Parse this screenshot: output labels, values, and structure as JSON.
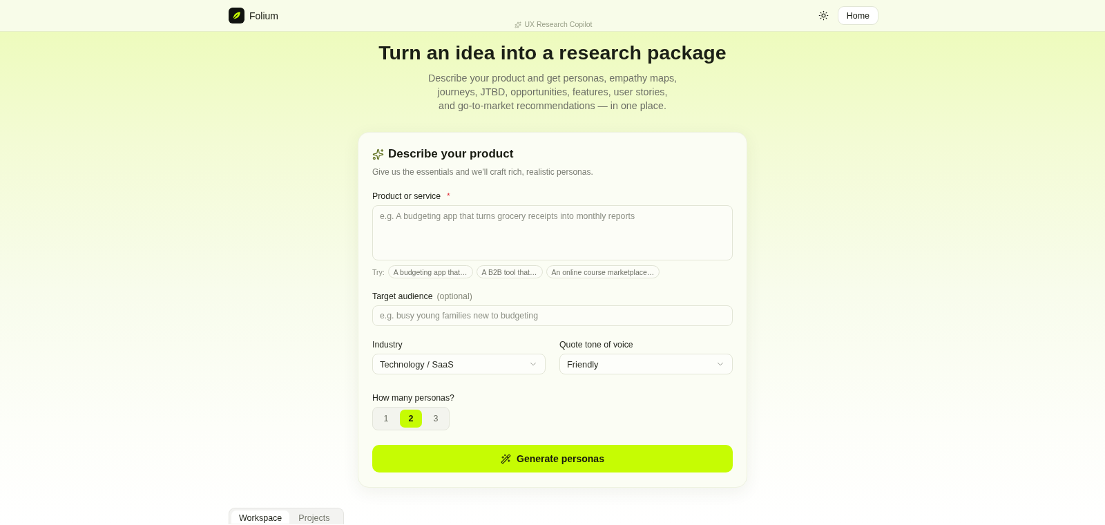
{
  "header": {
    "brand": "Folium",
    "home_button": "Home",
    "eyebrow": "UX Research Copilot"
  },
  "hero": {
    "title": "Turn an idea into a research package",
    "subtitle": "Describe your product and get personas, empathy maps, journeys, JTBD, opportunities, features, user stories, and go-to-market recommendations — in one place."
  },
  "card": {
    "title": "Describe your product",
    "subtitle": "Give us the essentials and we'll craft rich, realistic personas.",
    "product": {
      "label": "Product or service",
      "required_mark": "*",
      "placeholder": "e.g. A budgeting app that turns grocery receipts into monthly reports"
    },
    "suggestions": {
      "label": "Try:",
      "chips": [
        "A budgeting app that…",
        "A B2B tool that…",
        "An online course marketplace…"
      ]
    },
    "audience": {
      "label": "Target audience",
      "hint": "(optional)",
      "placeholder": "e.g. busy young families new to budgeting"
    },
    "selects": [
      {
        "label": "Industry",
        "value": "Technology / SaaS"
      },
      {
        "label": "Quote tone of voice",
        "value": "Friendly"
      }
    ],
    "persona_count": {
      "label": "How many personas?",
      "options": [
        {
          "label": "1",
          "selected": false
        },
        {
          "label": "2",
          "selected": true
        },
        {
          "label": "3",
          "selected": false
        }
      ]
    },
    "generate_button": "Generate personas"
  },
  "tabs": [
    {
      "label": "Workspace",
      "selected": true
    },
    {
      "label": "Projects",
      "selected": false
    }
  ]
}
